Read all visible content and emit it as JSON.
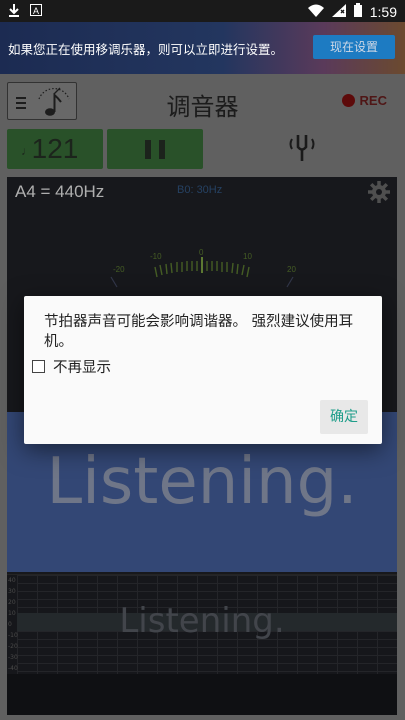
{
  "status_bar": {
    "time": "1:59"
  },
  "banner": {
    "text": "如果您正在使用移调乐器，则可以立即进行设置。",
    "button_label": "现在设置"
  },
  "header": {
    "title": "调音器",
    "rec_label": "REC"
  },
  "controls": {
    "bpm_value": "121"
  },
  "tuner": {
    "reference": "A4 = 440Hz",
    "range_hint": "B0: 30Hz",
    "gauge_ticks": [
      "-20",
      "-10",
      "0",
      "10",
      "20"
    ],
    "status_big": "Listening.",
    "status_small": "Listening.",
    "graph_labels": [
      "40",
      "30",
      "20",
      "10",
      "0",
      "-10",
      "-20",
      "-30",
      "-40"
    ]
  },
  "dialog": {
    "message": "节拍器声音可能会影响调谐器。 强烈建议使用耳机。",
    "checkbox_label": "不再显示",
    "checkbox_checked": false,
    "ok_label": "确定"
  },
  "colors": {
    "accent_green": "#2f5d2f",
    "dialog_button_text": "#1f9e8a",
    "listening_band": "#3b5186",
    "banner_button": "#1d7bc2"
  }
}
